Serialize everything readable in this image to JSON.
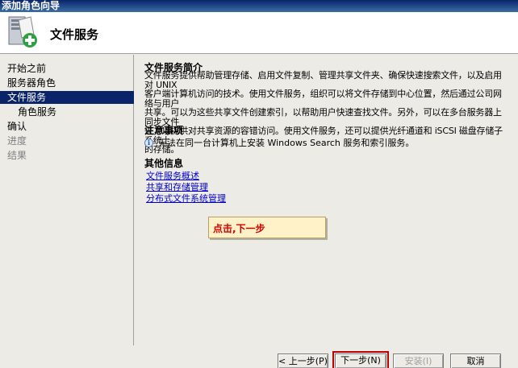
{
  "window": {
    "title": "添加角色向导"
  },
  "header": {
    "title": "文件服务",
    "icon": "server-add-icon"
  },
  "sidebar": {
    "items": [
      {
        "label": "开始之前",
        "state": "normal"
      },
      {
        "label": "服务器角色",
        "state": "normal"
      },
      {
        "label": "文件服务",
        "state": "active"
      },
      {
        "label": "角色服务",
        "state": "sub"
      },
      {
        "label": "确认",
        "state": "normal"
      },
      {
        "label": "进度",
        "state": "disabled"
      },
      {
        "label": "结果",
        "state": "disabled"
      }
    ]
  },
  "main": {
    "intro_title": "文件服务简介",
    "intro_lines": [
      "文件服务提供帮助管理存储、启用文件复制、管理共享文件夹、确保快速搜索文件，以及启用对 UNIX",
      "客户端计算机访问的技术。使用文件服务，组织可以将文件存储到中心位置，然后通过公司网络与用户",
      "共享。可以为这些共享文件创建索引，以帮助用户快速查找文件。另外，可以在多台服务器上同步文件",
      "夹，以提供对共享资源的容错访问。使用文件服务，还可以提供光纤通道和 iSCSI 磁盘存储子系统上",
      "的存储。"
    ],
    "notes_title": "注意事项",
    "note_text": "无法在同一台计算机上安装 Windows Search 服务和索引服务。",
    "more_info_title": "其他信息",
    "links": [
      "文件服务概述",
      "共享和存储管理",
      "分布式文件系统管理"
    ]
  },
  "callout": {
    "text": "点击,下一步"
  },
  "buttons": {
    "prev": "< 上一步(P)",
    "next": "下一步(N) >",
    "install": "安装(I)",
    "cancel": "取消"
  },
  "colors": {
    "selection": "#0a246a",
    "link": "#0000cc",
    "callout_text": "#d40000",
    "highlight_border": "#c00000"
  }
}
